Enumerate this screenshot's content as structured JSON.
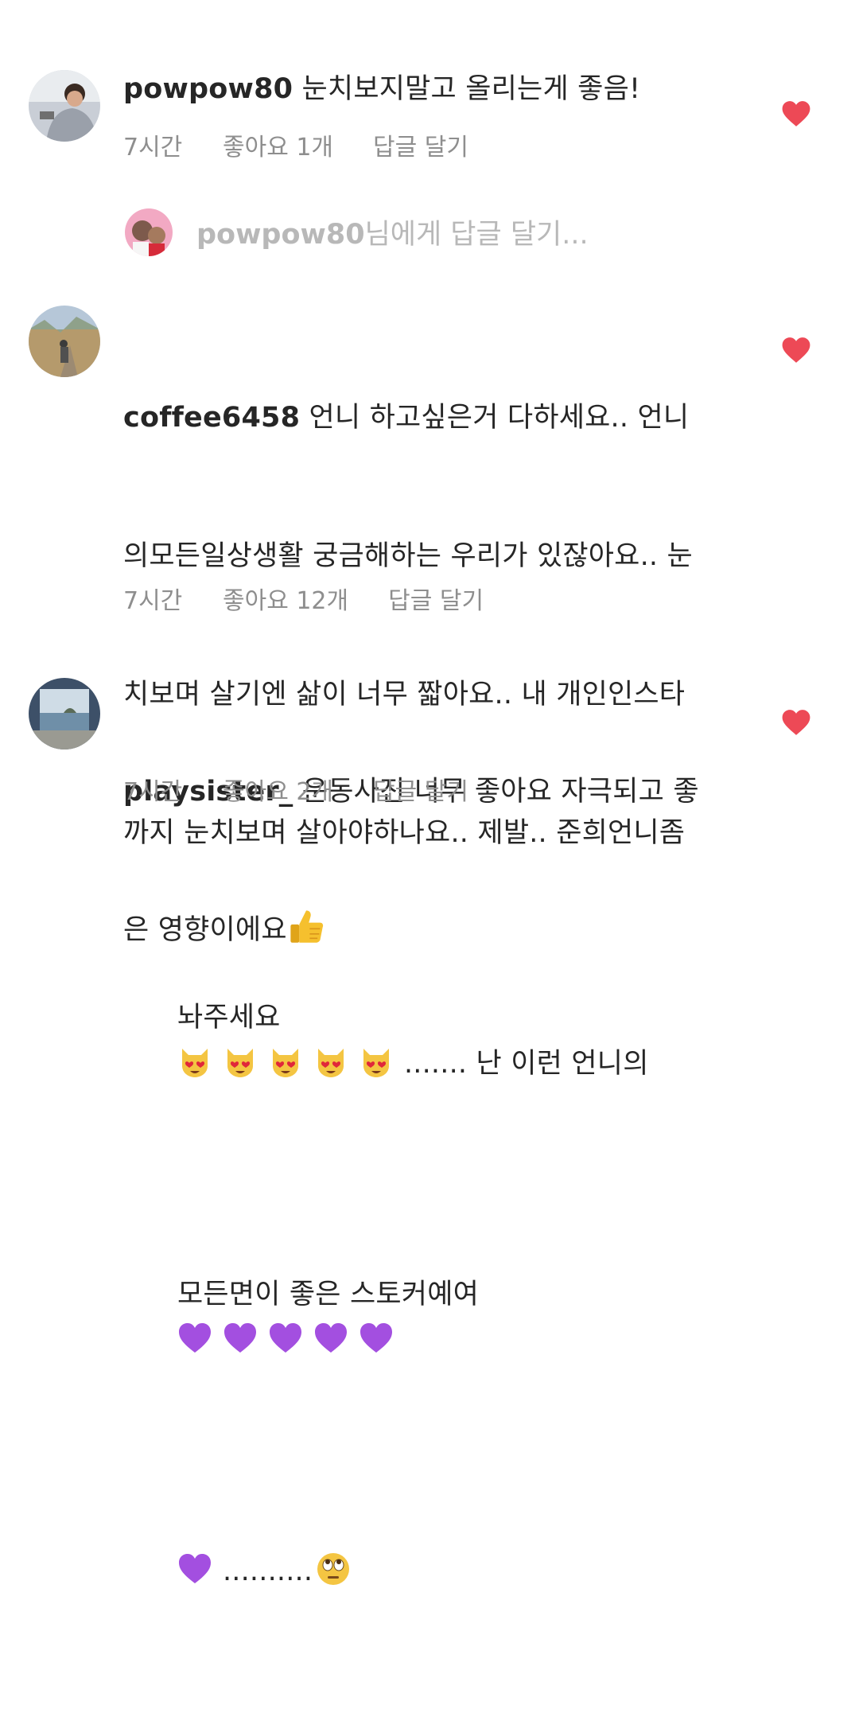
{
  "comments": [
    {
      "username": "powpow80",
      "text": " 눈치보지말고 올리는게 좋음!",
      "time": "7시간",
      "likes": "좋아요 1개",
      "reply": "답글 달기"
    },
    {
      "username": "coffee6458",
      "lines": [
        " 언니 하고싶은거 다하세요.. 언니",
        "의모든일상생활 궁금해하는 우리가 있잖아요.. 눈",
        "치보며 살기엔 삶이 너무 짧아요.. 내 개인인스타",
        "까지 눈치보며 살아야하나요.. 제발.. 준희언니좀",
        "놔주세요 ",
        "....... 난 이런 언니의",
        "모든면이 좋은 스토커예여 ",
        ".........."
      ],
      "time": "7시간",
      "likes": "좋아요 12개",
      "reply": "답글 달기"
    },
    {
      "username": "playsister_",
      "lines": [
        " 운동사진 너무 좋아요 자극되고 좋",
        "은 영향이에요"
      ],
      "time": "7시간",
      "likes": "좋아요 2개",
      "reply": "답글 달기"
    }
  ],
  "reply_input": {
    "placeholder_user": "powpow80",
    "placeholder_suffix": "님에게 답글 달기..."
  },
  "colors": {
    "heart": "#ed4956",
    "meta": "#8e8e8e",
    "placeholder": "#b8b8b8",
    "purple_heart": "#a34fe0"
  },
  "icons": {
    "heart": "heart-icon",
    "cat": "heart-eyes-cat-emoji",
    "purple": "purple-heart-emoji",
    "eyes": "rolling-eyes-emoji",
    "thumb": "thumbs-up-emoji"
  }
}
